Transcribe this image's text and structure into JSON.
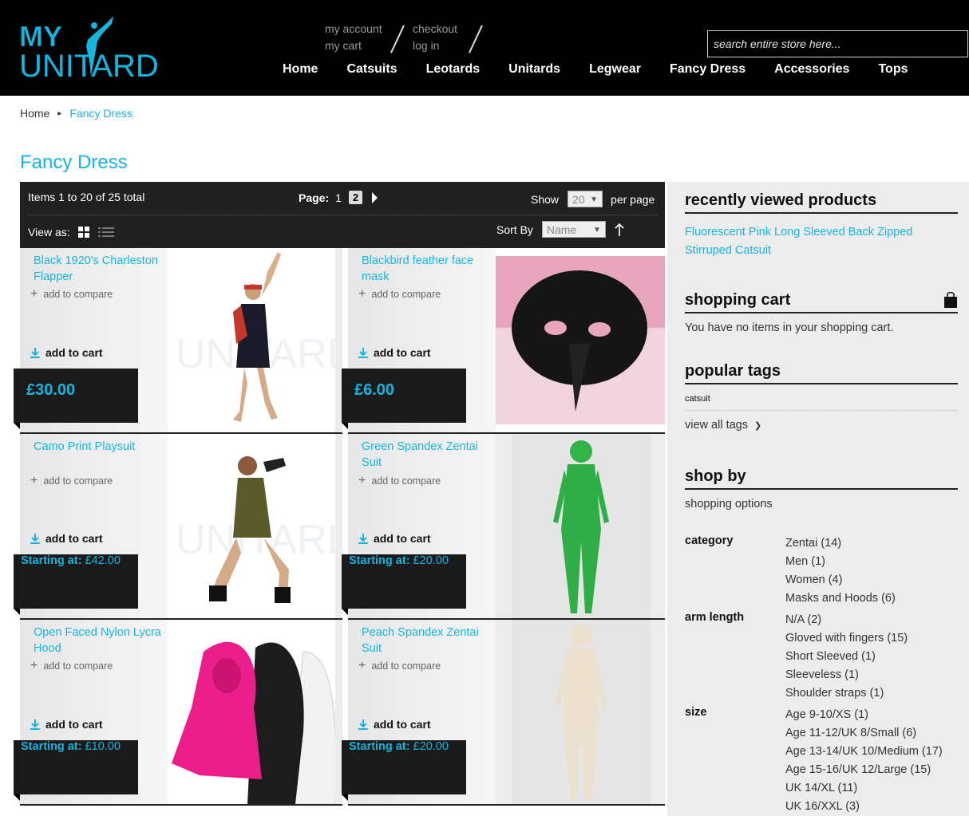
{
  "header": {
    "logo_top": "MY",
    "logo_bottom": "UNITARD",
    "toplinks": {
      "my_account": "my account",
      "my_cart": "my cart",
      "checkout": "checkout",
      "log_in": "log in"
    },
    "search_placeholder": "search entire store here...",
    "nav": [
      "Home",
      "Catsuits",
      "Leotards",
      "Unitards",
      "Legwear",
      "Fancy Dress",
      "Accessories",
      "Tops"
    ]
  },
  "breadcrumb": {
    "home": "Home",
    "current": "Fancy Dress"
  },
  "page_title": "Fancy Dress",
  "toolbar": {
    "amount": "Items 1 to 20 of 25 total",
    "page_label": "Page:",
    "pages": [
      "1",
      "2"
    ],
    "show_label": "Show",
    "show_value": "20",
    "per_page": "per page",
    "view_as": "View as:",
    "sort_by": "Sort By",
    "sort_value": "Name"
  },
  "products": [
    {
      "name": "Black 1920's Charleston Flapper",
      "compare": "add to compare",
      "cart": "add to cart",
      "price_prefix": "",
      "price": "£30.00"
    },
    {
      "name": "Blackbird feather face mask",
      "compare": "add to compare",
      "cart": "add to cart",
      "price_prefix": "",
      "price": "£6.00"
    },
    {
      "name": "Camo Print Playsuit",
      "compare": "add to compare",
      "cart": "add to cart",
      "price_prefix": "Starting at:",
      "price": "£42.00"
    },
    {
      "name": "Green Spandex Zentai Suit",
      "compare": "add to compare",
      "cart": "add to cart",
      "price_prefix": "Starting at:",
      "price": "£20.00"
    },
    {
      "name": "Open Faced Nylon Lycra Hood",
      "compare": "add to compare",
      "cart": "add to cart",
      "price_prefix": "Starting at:",
      "price": "£10.00"
    },
    {
      "name": "Peach Spandex Zentai Suit",
      "compare": "add to compare",
      "cart": "add to cart",
      "price_prefix": "Starting at:",
      "price": "£20.00"
    }
  ],
  "sidebar": {
    "recently_viewed_title": "recently viewed products",
    "recently_viewed_item": "Fluorescent Pink Long Sleeved Back Zipped Stirruped Catsuit",
    "cart_title": "shopping cart",
    "cart_empty": "You have no items in your shopping cart.",
    "tags_title": "popular tags",
    "tag": "catsuit",
    "view_all_tags": "view all tags",
    "shop_by_title": "shop by",
    "shopping_options": "shopping options",
    "filters": [
      {
        "label": "category",
        "values": [
          "Zentai (14)",
          "Men (1)",
          "Women (4)",
          "Masks and Hoods (6)"
        ]
      },
      {
        "label": "arm length",
        "values": [
          "N/A (2)",
          "Gloved with fingers (15)",
          "Short Sleeved (1)",
          "Sleeveless (1)",
          "Shoulder straps (1)"
        ]
      },
      {
        "label": "size",
        "values": [
          "Age 9-10/XS (1)",
          "Age 11-12/UK 8/Small (6)",
          "Age 13-14/UK 10/Medium (17)",
          "Age 15-16/UK 12/Large (15)",
          "UK 14/XL (11)",
          "UK 16/XXL (3)"
        ]
      }
    ]
  },
  "colors": {
    "accent": "#16b5e0",
    "dark": "#202020",
    "sidebar_bg": "#ececec"
  }
}
